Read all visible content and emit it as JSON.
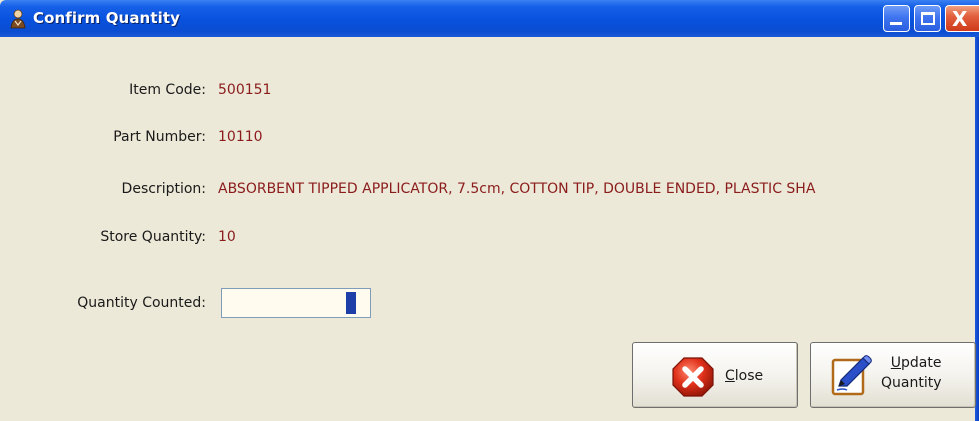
{
  "window": {
    "title": "Confirm Quantity",
    "icon": "app-person-icon",
    "controls": {
      "minimize_icon": "minimize-icon",
      "maximize_icon": "maximize-icon",
      "close_icon": "close-x-icon",
      "close_glyph": "X"
    }
  },
  "fields": {
    "item_code": {
      "label": "Item Code:",
      "value": "500151"
    },
    "part_number": {
      "label": "Part Number:",
      "value": "10110"
    },
    "description": {
      "label": "Description:",
      "value": "ABSORBENT TIPPED APPLICATOR, 7.5cm, COTTON TIP, DOUBLE ENDED, PLASTIC SHA"
    },
    "store_quantity": {
      "label": "Store Quantity:",
      "value": "10"
    },
    "quantity_counted": {
      "label": "Quantity Counted:",
      "value": ""
    }
  },
  "buttons": {
    "close": {
      "mnemonic": "C",
      "rest": "lose",
      "icon": "stop-x-icon"
    },
    "update": {
      "line1_mnemonic": "U",
      "line1_rest": "pdate",
      "line2": "Quantity",
      "icon": "edit-pen-icon"
    }
  },
  "colors": {
    "titlebar": "#0b4dd1",
    "window_bg": "#ece9d8",
    "value_text": "#8b1c1c",
    "input_bg": "#fffbef"
  }
}
